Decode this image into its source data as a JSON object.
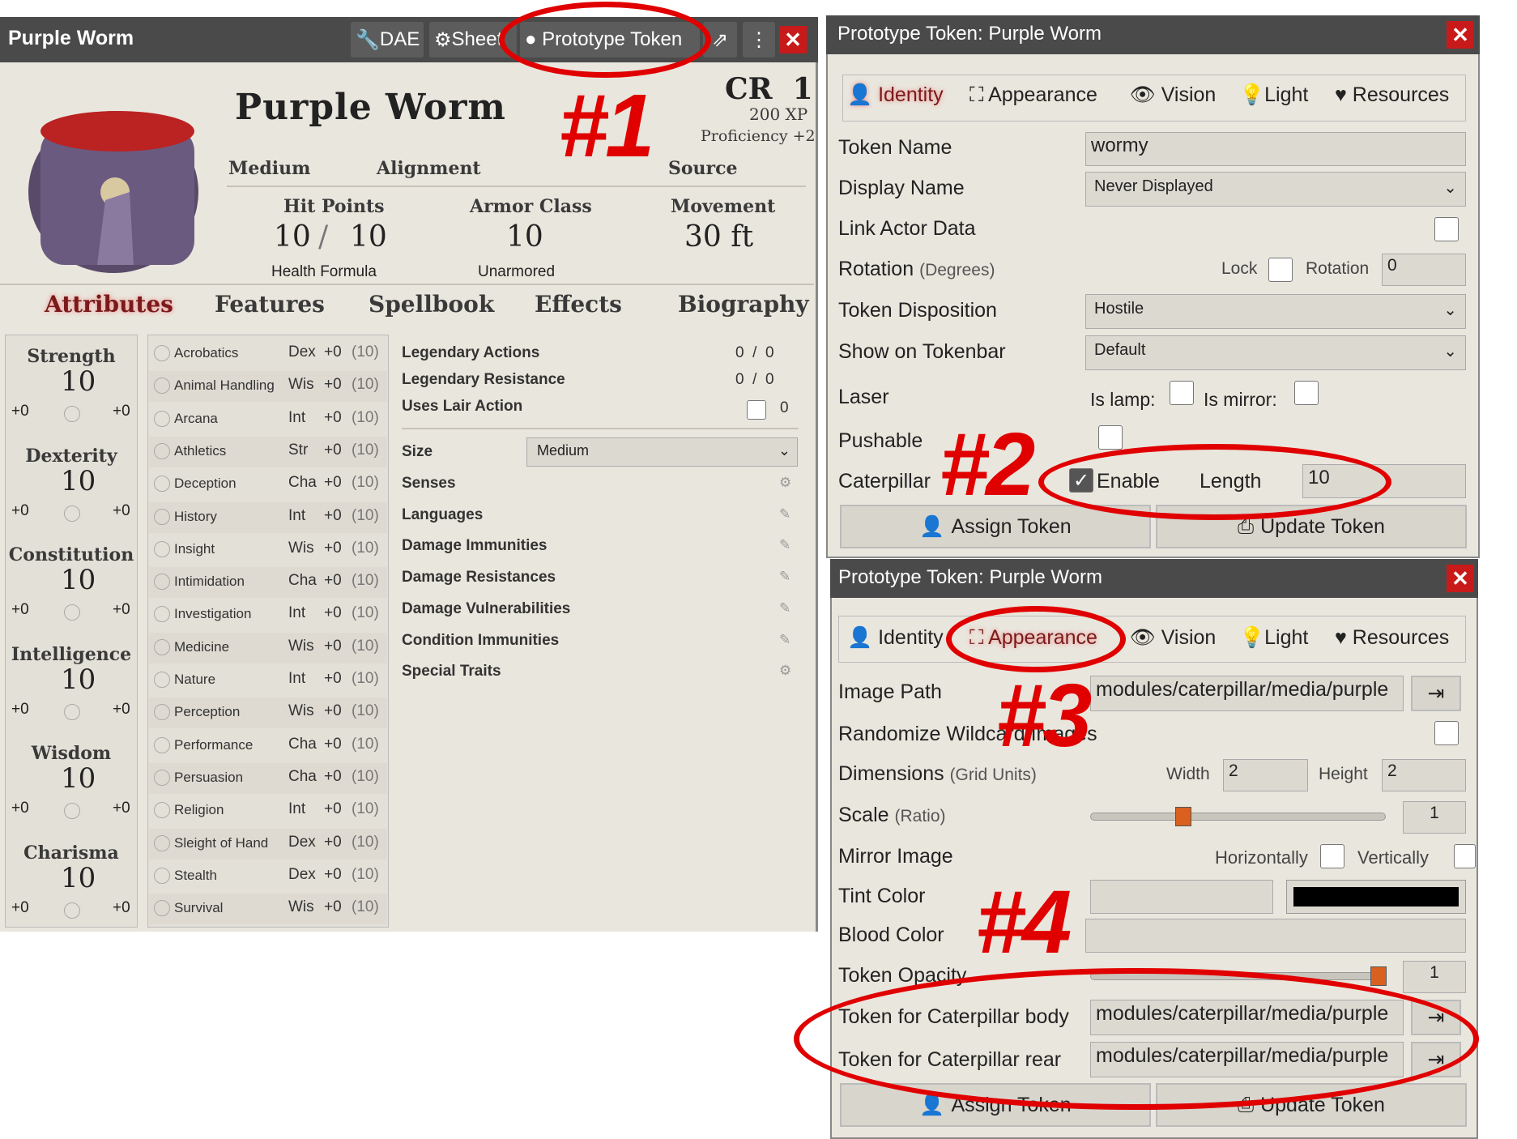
{
  "actor": {
    "window_title": "Purple Worm",
    "header_buttons": [
      "DAE",
      "Sheet",
      "Prototype Token"
    ],
    "name": "Purple Worm",
    "cr_label": "CR",
    "cr": "1",
    "xp": "200 XP",
    "proficiency": "Proficiency +2",
    "meta": [
      "Medium",
      "Alignment",
      "Source"
    ],
    "stats": [
      {
        "label": "Hit Points",
        "value": "10",
        "max": "10",
        "sub": "Health Formula"
      },
      {
        "label": "Armor Class",
        "value": "10",
        "sub": "Unarmored"
      },
      {
        "label": "Movement",
        "value": "30 ft"
      }
    ],
    "tabs": [
      "Attributes",
      "Features",
      "Spellbook",
      "Effects",
      "Biography"
    ],
    "abilities": [
      {
        "name": "Strength",
        "score": "10",
        "mod": "+0",
        "save": "+0"
      },
      {
        "name": "Dexterity",
        "score": "10",
        "mod": "+0",
        "save": "+0"
      },
      {
        "name": "Constitution",
        "score": "10",
        "mod": "+0",
        "save": "+0"
      },
      {
        "name": "Intelligence",
        "score": "10",
        "mod": "+0",
        "save": "+0"
      },
      {
        "name": "Wisdom",
        "score": "10",
        "mod": "+0",
        "save": "+0"
      },
      {
        "name": "Charisma",
        "score": "10",
        "mod": "+0",
        "save": "+0"
      }
    ],
    "skills": [
      [
        "Acrobatics",
        "Dex"
      ],
      [
        "Animal Handling",
        "Wis"
      ],
      [
        "Arcana",
        "Int"
      ],
      [
        "Athletics",
        "Str"
      ],
      [
        "Deception",
        "Cha"
      ],
      [
        "History",
        "Int"
      ],
      [
        "Insight",
        "Wis"
      ],
      [
        "Intimidation",
        "Cha"
      ],
      [
        "Investigation",
        "Int"
      ],
      [
        "Medicine",
        "Wis"
      ],
      [
        "Nature",
        "Int"
      ],
      [
        "Perception",
        "Wis"
      ],
      [
        "Performance",
        "Cha"
      ],
      [
        "Persuasion",
        "Cha"
      ],
      [
        "Religion",
        "Int"
      ],
      [
        "Sleight of Hand",
        "Dex"
      ],
      [
        "Stealth",
        "Dex"
      ],
      [
        "Survival",
        "Wis"
      ]
    ],
    "skill_mod": "+0",
    "skill_passive": "(10)",
    "traits": {
      "legendary_actions": "Legendary Actions",
      "la": [
        "0",
        "0"
      ],
      "legendary_resistance": "Legendary Resistance",
      "lr": [
        "0",
        "0"
      ],
      "lair": "Uses Lair Action",
      "lair_val": "0",
      "size_label": "Size",
      "size_value": "Medium",
      "list": [
        "Senses",
        "Languages",
        "Damage Immunities",
        "Damage Resistances",
        "Damage Vulnerabilities",
        "Condition Immunities",
        "Special Traits"
      ]
    }
  },
  "token1": {
    "title": "Prototype Token: Purple Worm",
    "tabs": [
      "Identity",
      "Appearance",
      "Vision",
      "Light",
      "Resources"
    ],
    "token_name_label": "Token Name",
    "token_name": "wormy",
    "display_name_label": "Display Name",
    "display_name": "Never Displayed",
    "link_label": "Link Actor Data",
    "rotation_label": "Rotation",
    "rotation_unit": "(Degrees)",
    "lock": "Lock",
    "rotation_field": "Rotation",
    "rotation_value": "0",
    "disposition_label": "Token Disposition",
    "disposition": "Hostile",
    "tokenbar_label": "Show on Tokenbar",
    "tokenbar": "Default",
    "laser": "Laser",
    "is_lamp": "Is lamp:",
    "is_mirror": "Is mirror:",
    "pushable": "Pushable",
    "caterpillar": "Caterpillar",
    "enable": "Enable",
    "length_label": "Length",
    "length": "10",
    "assign": "Assign Token",
    "update": "Update Token"
  },
  "token2": {
    "title": "Prototype Token: Purple Worm",
    "tabs": [
      "Identity",
      "Appearance",
      "Vision",
      "Light",
      "Resources"
    ],
    "image_path_label": "Image Path",
    "image_path": "modules/caterpillar/media/purple",
    "randomize": "Randomize Wildcard Images",
    "dimensions_label": "Dimensions",
    "dimensions_unit": "(Grid Units)",
    "width_label": "Width",
    "width": "2",
    "height_label": "Height",
    "height": "2",
    "scale_label": "Scale",
    "scale_unit": "(Ratio)",
    "scale": "1",
    "scale_fraction": 0.3,
    "mirror_label": "Mirror Image",
    "horizontally": "Horizontally",
    "vertically": "Vertically",
    "tint_label": "Tint Color",
    "blood_label": "Blood Color",
    "opacity_label": "Token Opacity",
    "opacity": "1",
    "opacity_fraction": 1,
    "body_label": "Token for Caterpillar body",
    "body_path": "modules/caterpillar/media/purple",
    "rear_label": "Token for Caterpillar rear",
    "rear_path": "modules/caterpillar/media/purple",
    "assign": "Assign Token",
    "update": "Update Token"
  },
  "annotations": [
    "#1",
    "#2",
    "#3",
    "#4"
  ],
  "colors": {
    "accent": "#e00000",
    "header": "#4a4a4a",
    "close": "#c81a1a",
    "orange": "#d9601f"
  }
}
